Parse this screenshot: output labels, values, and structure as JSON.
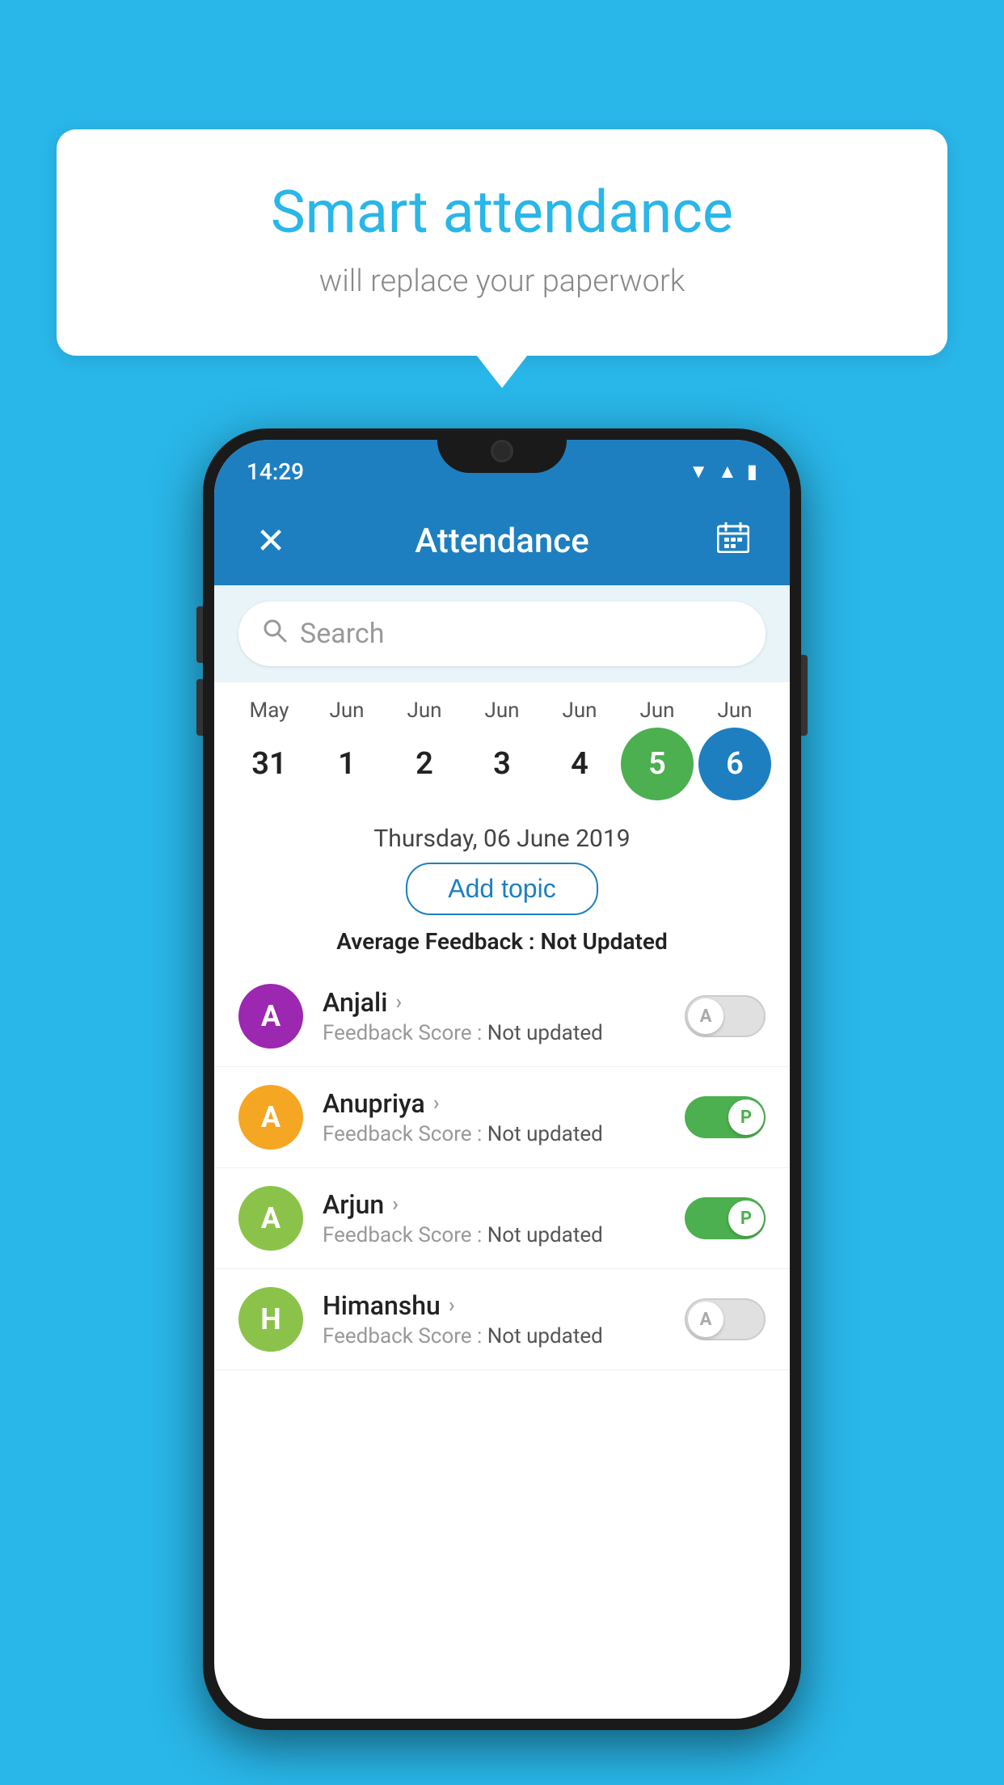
{
  "background_color": "#29b6e8",
  "bubble": {
    "title": "Smart attendance",
    "subtitle": "will replace your paperwork"
  },
  "status_bar": {
    "time": "14:29",
    "wifi": "▼",
    "signal": "▲",
    "battery": "▮"
  },
  "app_bar": {
    "title": "Attendance",
    "close_icon": "✕",
    "calendar_icon": "📅"
  },
  "search": {
    "placeholder": "Search"
  },
  "calendar": {
    "months": [
      "May",
      "Jun",
      "Jun",
      "Jun",
      "Jun",
      "Jun",
      "Jun"
    ],
    "dates": [
      31,
      1,
      2,
      3,
      4,
      5,
      6
    ],
    "today_index": 5,
    "selected_index": 6
  },
  "selected_date": "Thursday, 06 June 2019",
  "add_topic_label": "Add topic",
  "average_feedback": {
    "label": "Average Feedback : ",
    "value": "Not Updated"
  },
  "students": [
    {
      "name": "Anjali",
      "initial": "A",
      "avatar_color": "#9c27b0",
      "feedback_label": "Feedback Score : ",
      "feedback_value": "Not updated",
      "status": "absent"
    },
    {
      "name": "Anupriya",
      "initial": "A",
      "avatar_color": "#f5a623",
      "feedback_label": "Feedback Score : ",
      "feedback_value": "Not updated",
      "status": "present"
    },
    {
      "name": "Arjun",
      "initial": "A",
      "avatar_color": "#8bc34a",
      "feedback_label": "Feedback Score : ",
      "feedback_value": "Not updated",
      "status": "present"
    },
    {
      "name": "Himanshu",
      "initial": "H",
      "avatar_color": "#8bc34a",
      "feedback_label": "Feedback Score : ",
      "feedback_value": "Not updated",
      "status": "absent"
    }
  ]
}
